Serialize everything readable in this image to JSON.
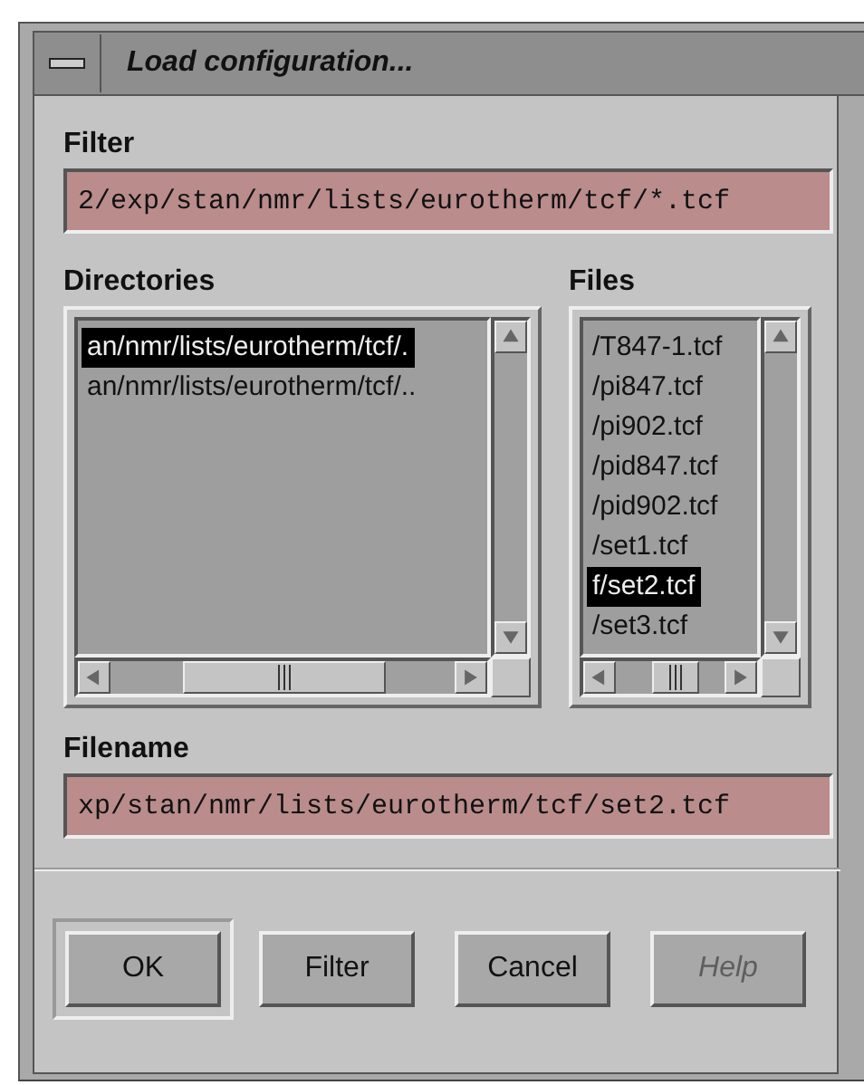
{
  "window": {
    "title": "Load configuration..."
  },
  "filter": {
    "label": "Filter",
    "value": "2/exp/stan/nmr/lists/eurotherm/tcf/*.tcf"
  },
  "directories": {
    "label": "Directories",
    "items": [
      {
        "text": "an/nmr/lists/eurotherm/tcf/.",
        "selected": true
      },
      {
        "text": "an/nmr/lists/eurotherm/tcf/..",
        "selected": false
      }
    ]
  },
  "files": {
    "label": "Files",
    "items": [
      {
        "text": "/T847-1.tcf",
        "selected": false
      },
      {
        "text": "/pi847.tcf",
        "selected": false
      },
      {
        "text": "/pi902.tcf",
        "selected": false
      },
      {
        "text": "/pid847.tcf",
        "selected": false
      },
      {
        "text": "/pid902.tcf",
        "selected": false
      },
      {
        "text": "/set1.tcf",
        "selected": false
      },
      {
        "text": "f/set2.tcf",
        "selected": true
      },
      {
        "text": "/set3.tcf",
        "selected": false
      }
    ]
  },
  "filename": {
    "label": "Filename",
    "value": "xp/stan/nmr/lists/eurotherm/tcf/set2.tcf"
  },
  "buttons": [
    {
      "label": "OK",
      "default": true,
      "disabled": false
    },
    {
      "label": "Filter",
      "default": false,
      "disabled": false
    },
    {
      "label": "Cancel",
      "default": false,
      "disabled": false
    },
    {
      "label": "Help",
      "default": false,
      "disabled": true
    }
  ]
}
